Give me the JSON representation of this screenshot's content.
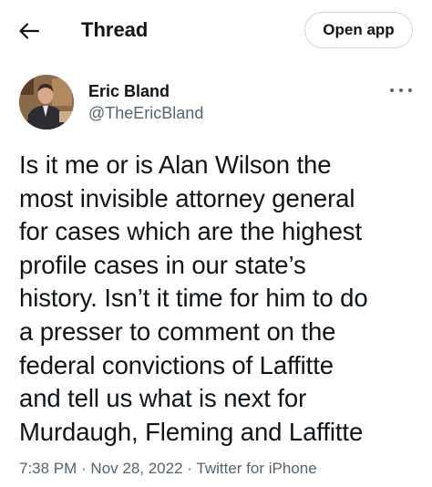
{
  "header": {
    "back_icon": "arrow-left-icon",
    "title": "Thread",
    "open_app_label": "Open app"
  },
  "author": {
    "name": "Eric Bland",
    "handle": "@TheEricBland",
    "more_icon": "more-horizontal-icon"
  },
  "tweet": {
    "text": "Is it me or is Alan Wilson the\nmost invisible attorney general\nfor cases which are the highest\nprofile cases in our state’s\nhistory. Isn’t it time for him to do\na presser to comment on the\nfederal convictions of Laffitte\nand tell us what is next for\nMurdaugh, Fleming and Laffitte",
    "time": "7:38 PM",
    "separator": " · ",
    "date": "Nov 28, 2022",
    "source": "Twitter for iPhone"
  },
  "colors": {
    "text_primary": "#0f1419",
    "text_secondary": "#536471",
    "border": "#cfd9de"
  }
}
